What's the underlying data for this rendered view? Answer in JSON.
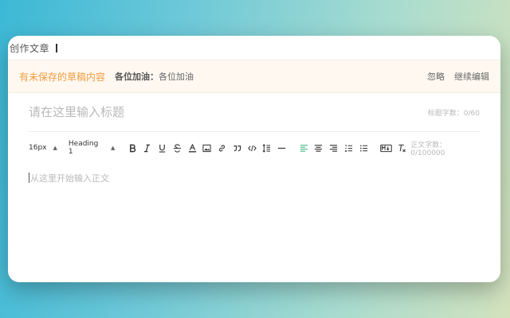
{
  "header": {
    "title": "创作文章"
  },
  "draft_bar": {
    "message": "有未保存的草稿内容",
    "author_label": "各位加油：",
    "author_value": "各位加油",
    "ignore_label": "忽略",
    "continue_label": "继续编辑"
  },
  "editor": {
    "title_placeholder": "请在这里输入标题",
    "title_counter": "标题字数：0/60",
    "font_size": "16px",
    "heading": "Heading 1",
    "body_placeholder": "从这里开始输入正文",
    "body_counter": "正文字数：0/100000"
  },
  "colors": {
    "accent": "#42b983",
    "warning": "#f39c3c",
    "draft_background": "#fef8f1"
  },
  "toolbar_icons": [
    "bold-icon",
    "italic-icon",
    "underline-icon",
    "strikethrough-icon",
    "font-color-icon",
    "image-icon",
    "link-icon",
    "quote-icon",
    "code-icon",
    "line-height-icon",
    "divider-icon",
    "align-left-icon",
    "align-center-icon",
    "align-right-icon",
    "ordered-list-icon",
    "unordered-list-icon",
    "markdown-icon",
    "clear-format-icon"
  ]
}
